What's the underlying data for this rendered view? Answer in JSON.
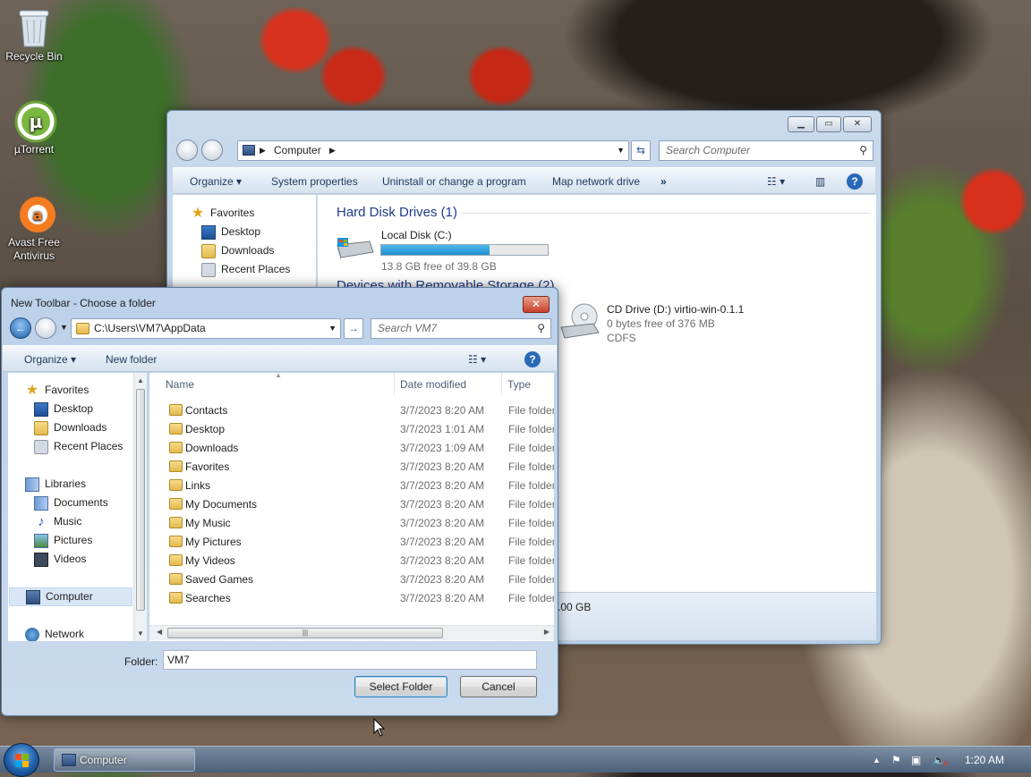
{
  "desktop": {
    "icons": [
      {
        "label": "Recycle Bin",
        "icon": "recycle-bin-icon"
      },
      {
        "label": "µTorrent",
        "icon": "utorrent-icon"
      },
      {
        "label": "Avast Free Antivirus",
        "icon": "avast-icon"
      }
    ]
  },
  "explorer": {
    "address": {
      "crumb": "Computer"
    },
    "search_placeholder": "Search Computer",
    "toolbar": {
      "organize": "Organize",
      "system_properties": "System properties",
      "uninstall": "Uninstall or change a program",
      "map_drive": "Map network drive",
      "more": "»"
    },
    "nav": {
      "favorites": "Favorites",
      "desktop": "Desktop",
      "downloads": "Downloads",
      "recent": "Recent Places"
    },
    "groups": {
      "hdd": "Hard Disk Drives (1)",
      "removable": "Devices with Removable Storage (2)"
    },
    "drives": {
      "c_name": "Local Disk (C:)",
      "c_free": "13.8 GB free of 39.8 GB",
      "c_used_fraction": 0.65,
      "d_name": "CD Drive (D:) virtio-win-0.1.1",
      "d_free": "0 bytes free of 376 MB",
      "d_fs": "CDFS"
    },
    "status_partial": ".00 GB",
    "accent": "#26a0da"
  },
  "dialog": {
    "title": "New Toolbar - Choose a folder",
    "address": "C:\\Users\\VM7\\AppData",
    "search_placeholder": "Search VM7",
    "toolbar": {
      "organize": "Organize",
      "new_folder": "New folder"
    },
    "nav": {
      "favorites": "Favorites",
      "desktop": "Desktop",
      "downloads": "Downloads",
      "recent": "Recent Places",
      "libraries": "Libraries",
      "documents": "Documents",
      "music": "Music",
      "pictures": "Pictures",
      "videos": "Videos",
      "computer": "Computer",
      "network": "Network"
    },
    "columns": {
      "name": "Name",
      "date": "Date modified",
      "type": "Type"
    },
    "files": [
      {
        "name": "Contacts",
        "date": "3/7/2023 8:20 AM",
        "type": "File folder"
      },
      {
        "name": "Desktop",
        "date": "3/7/2023 1:01 AM",
        "type": "File folder"
      },
      {
        "name": "Downloads",
        "date": "3/7/2023 1:09 AM",
        "type": "File folder"
      },
      {
        "name": "Favorites",
        "date": "3/7/2023 8:20 AM",
        "type": "File folder"
      },
      {
        "name": "Links",
        "date": "3/7/2023 8:20 AM",
        "type": "File folder"
      },
      {
        "name": "My Documents",
        "date": "3/7/2023 8:20 AM",
        "type": "File folder"
      },
      {
        "name": "My Music",
        "date": "3/7/2023 8:20 AM",
        "type": "File folder"
      },
      {
        "name": "My Pictures",
        "date": "3/7/2023 8:20 AM",
        "type": "File folder"
      },
      {
        "name": "My Videos",
        "date": "3/7/2023 8:20 AM",
        "type": "File folder"
      },
      {
        "name": "Saved Games",
        "date": "3/7/2023 8:20 AM",
        "type": "File folder"
      },
      {
        "name": "Searches",
        "date": "3/7/2023 8:20 AM",
        "type": "File folder"
      }
    ],
    "folder_label": "Folder:",
    "folder_value": "VM7",
    "select_button": "Select Folder",
    "cancel_button": "Cancel"
  },
  "taskbar": {
    "task": "Computer",
    "clock": "1:20 AM"
  }
}
